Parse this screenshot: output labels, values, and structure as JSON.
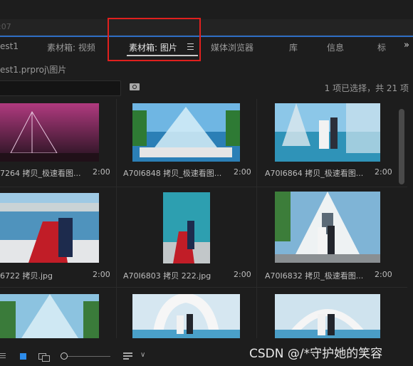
{
  "timecode_fragment": ":07",
  "tabs": [
    {
      "label": "est1"
    },
    {
      "label": "素材箱: 视频"
    },
    {
      "label": "素材箱: 图片",
      "active": true
    },
    {
      "label": "媒体浏览器"
    },
    {
      "label": "库"
    },
    {
      "label": "信息"
    },
    {
      "label": "标"
    }
  ],
  "tabs_overflow": "»",
  "breadcrumb": "est1.prproj\\图片",
  "search": {
    "value": "",
    "placeholder": ""
  },
  "selection_status": "1 项已选择，共 21 项",
  "items": [
    {
      "name": "7264 拷贝_极速看图...",
      "duration": "2:00"
    },
    {
      "name": "A70I6848 拷贝_极速看图...",
      "duration": "2:00"
    },
    {
      "name": "A70I6864 拷贝_极速看图...",
      "duration": "2:00"
    },
    {
      "name": "6722 拷贝.jpg",
      "duration": "2:00"
    },
    {
      "name": "A70I6803 拷贝 222.jpg",
      "duration": "2:00"
    },
    {
      "name": "A70I6832 拷贝_极速看图...",
      "duration": "2:00"
    },
    {
      "name": "",
      "duration": ""
    },
    {
      "name": "",
      "duration": ""
    },
    {
      "name": "",
      "duration": ""
    }
  ],
  "watermark": "CSDN @/*守护她的笑容",
  "colors": {
    "accent": "#2d8ceb",
    "highlight_box": "#e0201e",
    "background": "#1d1d1d"
  },
  "icons": [
    "find-icon",
    "list-view-icon",
    "icon-view-icon",
    "freeform-view-icon",
    "zoom-slider",
    "sort-icon",
    "overflow-chevron-icon"
  ]
}
